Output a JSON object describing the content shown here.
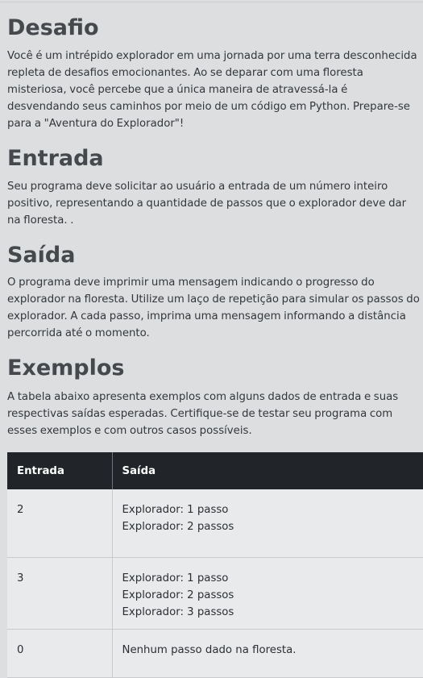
{
  "sections": {
    "desafio": {
      "title": "Desafio",
      "text": "Você é um intrépido explorador em uma jornada por uma terra desconhecida repleta de desafios emocionantes. Ao se deparar com uma floresta misteriosa, você percebe que a única maneira de atravessá-la é desvendando seus caminhos por meio de um código em Python. Prepare-se para a \"Aventura do Explorador\"!"
    },
    "entrada": {
      "title": "Entrada",
      "text": "Seu programa deve solicitar ao usuário a entrada de um número inteiro positivo, representando a quantidade de passos que o explorador deve dar na floresta. ."
    },
    "saida": {
      "title": "Saída",
      "text": "O programa deve imprimir uma mensagem indicando o progresso do explorador na floresta. Utilize um laço de repetição para simular os passos do explorador. A cada passo, imprima uma mensagem informando a distância percorrida até o momento."
    },
    "exemplos": {
      "title": "Exemplos",
      "text": "A tabela abaixo apresenta exemplos com alguns dados de entrada e suas respectivas saídas esperadas. Certifique-se de testar seu programa com esses exemplos e com outros casos possíveis."
    }
  },
  "table": {
    "headers": [
      "Entrada",
      "Saída"
    ],
    "rows": [
      {
        "input": "2",
        "output": [
          "Explorador: 1 passo",
          "Explorador: 2 passos"
        ]
      },
      {
        "input": "3",
        "output": [
          "Explorador: 1 passo",
          "Explorador: 2 passos",
          "Explorador: 3 passos"
        ]
      },
      {
        "input": "0",
        "output": [
          "Nenhum passo dado na floresta."
        ]
      }
    ]
  }
}
